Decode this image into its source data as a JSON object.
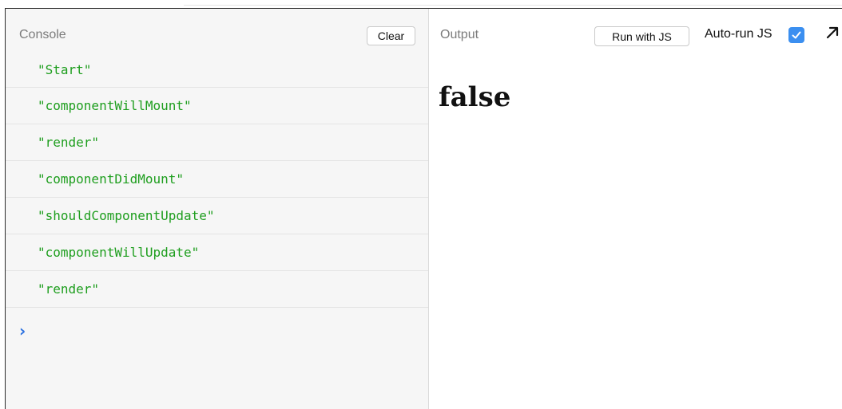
{
  "console": {
    "title": "Console",
    "clear_label": "Clear",
    "logs": [
      "\"Start\"",
      "\"componentWillMount\"",
      "\"render\"",
      "\"componentDidMount\"",
      "\"shouldComponentUpdate\"",
      "\"componentWillUpdate\"",
      "\"render\""
    ],
    "prompt_symbol": "›"
  },
  "output": {
    "title": "Output",
    "run_label": "Run with JS",
    "autorun_label": "Auto-run JS",
    "autorun_checked": true,
    "result_text": "false"
  },
  "colors": {
    "log_text": "#1e9e1e",
    "prompt": "#2d72e0",
    "checkbox": "#3b8ff0"
  },
  "icons": {
    "prompt": "chevron-right-icon",
    "checkbox": "check-icon",
    "popout": "arrow-up-right-icon"
  }
}
